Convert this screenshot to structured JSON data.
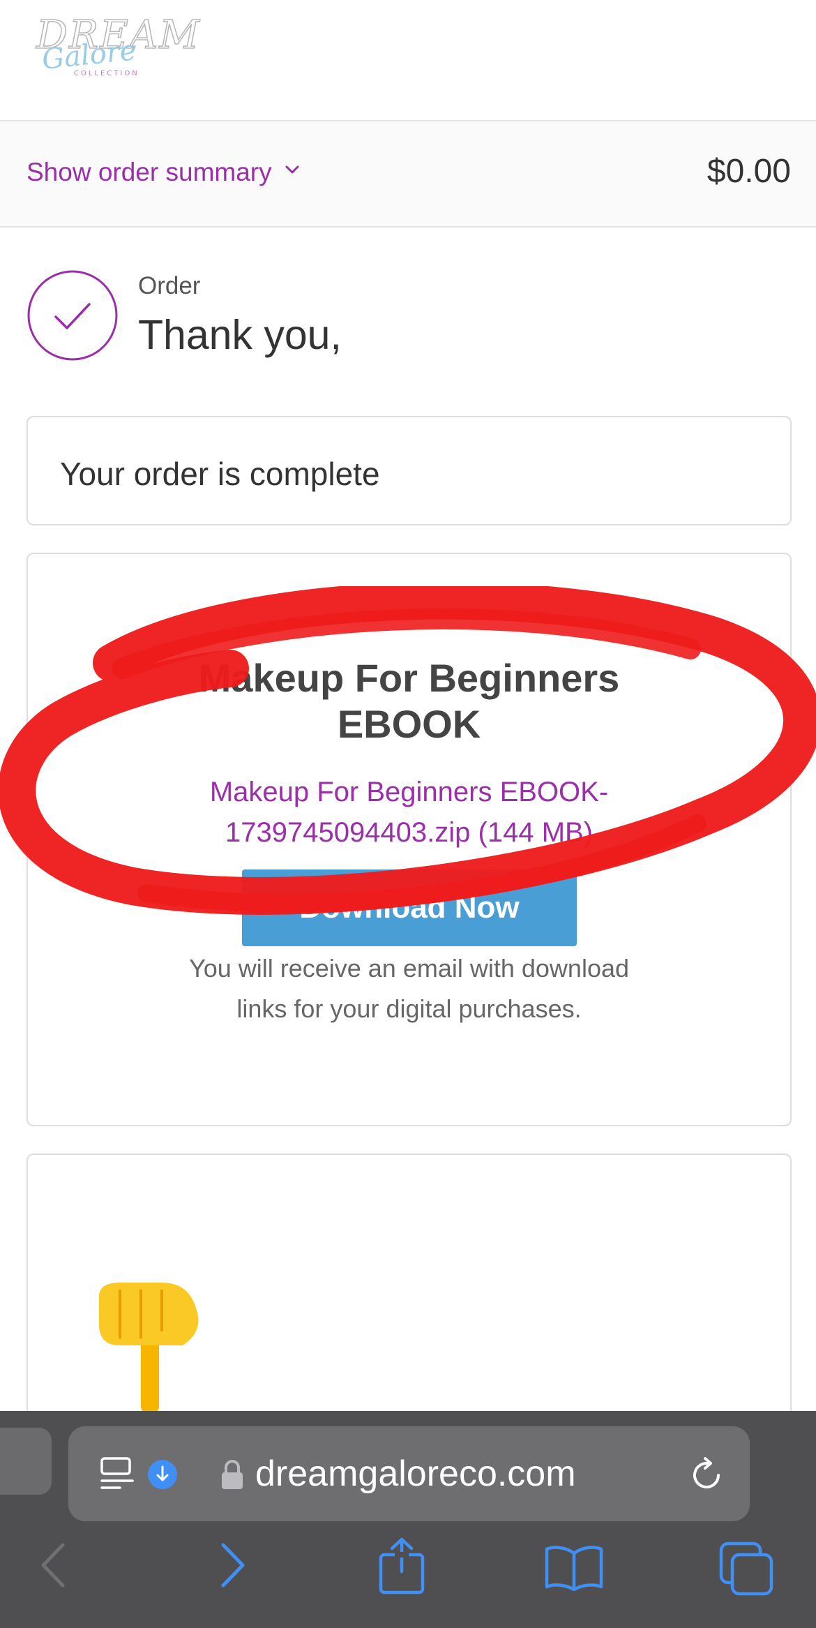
{
  "logo": {
    "main": "DREAM",
    "script": "Galore",
    "sub": "COLLECTION"
  },
  "summary": {
    "toggle_label": "Show order summary",
    "total": "$0.00"
  },
  "confirmation": {
    "order_label": "Order",
    "thank_you": "Thank you,"
  },
  "status_card": {
    "message": "Your order is complete"
  },
  "download_card": {
    "title_line1": "Makeup For Beginners",
    "title_line2": "EBOOK",
    "file_line1": "Makeup For Beginners EBOOK-",
    "file_line2": "1739745094403.zip (144 MB)",
    "button_label": "Download Now",
    "note_line1": "You will receive an email with download",
    "note_line2": "links for your digital purchases."
  },
  "browser": {
    "url": "dreamgaloreco.com"
  },
  "icons": {
    "checkmark": "check-circle-icon",
    "chevron": "chevron-down-icon",
    "reader": "reader-icon",
    "download_indicator": "download-icon",
    "lock": "lock-icon",
    "reload": "reload-icon",
    "back": "back-arrow-icon",
    "forward": "forward-arrow-icon",
    "share": "share-icon",
    "bookmarks": "bookmarks-icon",
    "tabs": "tabs-icon",
    "annotation_hand": "pointing-hand-emoji"
  },
  "colors": {
    "accent_purple": "#9a2fa9",
    "button_blue": "#4a9ed6",
    "annotation_red": "#ee1c1c",
    "safari_chrome": "#4f4f51",
    "safari_blue": "#3f8ff4"
  }
}
